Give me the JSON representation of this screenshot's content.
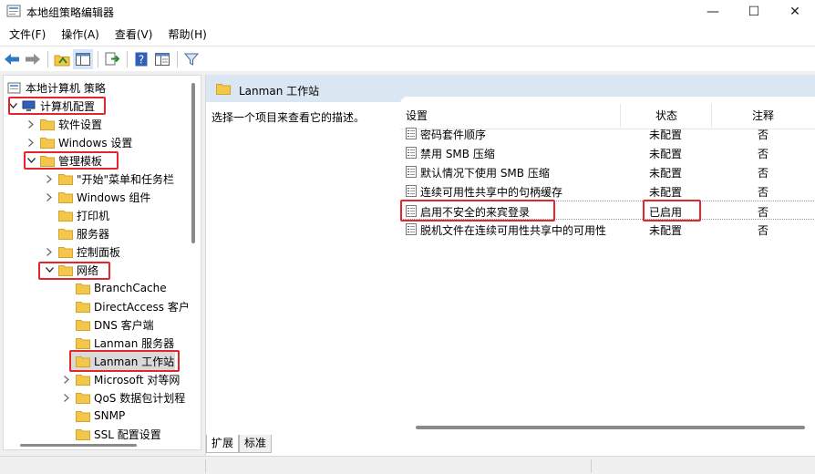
{
  "window": {
    "title": "本地组策略编辑器",
    "minimize_icon": "—",
    "maximize_icon": "☐",
    "close_icon": "✕"
  },
  "menu": [
    {
      "label": "文件(F)"
    },
    {
      "label": "操作(A)"
    },
    {
      "label": "查看(V)"
    },
    {
      "label": "帮助(H)"
    }
  ],
  "toolbar": {
    "icons": [
      "back-arrow-icon",
      "forward-arrow-icon",
      "up-folder-icon",
      "show-hide-tree-icon",
      "export-list-icon",
      "help-icon",
      "properties-icon",
      "filter-icon"
    ]
  },
  "tree": {
    "items": [
      {
        "label": "本地计算机 策略"
      },
      {
        "label": "计算机配置"
      },
      {
        "label": "软件设置"
      },
      {
        "label": "Windows 设置"
      },
      {
        "label": "管理模板"
      },
      {
        "label": "\"开始\"菜单和任务栏"
      },
      {
        "label": "Windows 组件"
      },
      {
        "label": "打印机"
      },
      {
        "label": "服务器"
      },
      {
        "label": "控制面板"
      },
      {
        "label": "网络"
      },
      {
        "label": "BranchCache"
      },
      {
        "label": "DirectAccess 客户"
      },
      {
        "label": "DNS 客户端"
      },
      {
        "label": "Lanman 服务器"
      },
      {
        "label": "Lanman 工作站"
      },
      {
        "label": "Microsoft 对等网"
      },
      {
        "label": "QoS 数据包计划程"
      },
      {
        "label": "SNMP"
      },
      {
        "label": "SSL 配置设置"
      }
    ]
  },
  "right": {
    "header_title": "Lanman 工作站",
    "description": "选择一个项目来查看它的描述。",
    "columns": {
      "setting": "设置",
      "state": "状态",
      "note": "注释"
    },
    "rows": [
      {
        "name": "密码套件顺序",
        "state": "未配置",
        "note": "否"
      },
      {
        "name": "禁用 SMB 压缩",
        "state": "未配置",
        "note": "否"
      },
      {
        "name": "默认情况下使用 SMB 压缩",
        "state": "未配置",
        "note": "否"
      },
      {
        "name": "连续可用性共享中的句柄缓存",
        "state": "未配置",
        "note": "否"
      },
      {
        "name": "启用不安全的来宾登录",
        "state": "已启用",
        "note": "否"
      },
      {
        "name": "脱机文件在连续可用性共享中的可用性",
        "state": "未配置",
        "note": "否"
      }
    ]
  },
  "tabs": [
    {
      "label": "扩展"
    },
    {
      "label": "标准"
    }
  ],
  "colors": {
    "highlight": "#e1262c",
    "header_bg": "#dbe6f3",
    "folder": "#f4c64a"
  }
}
